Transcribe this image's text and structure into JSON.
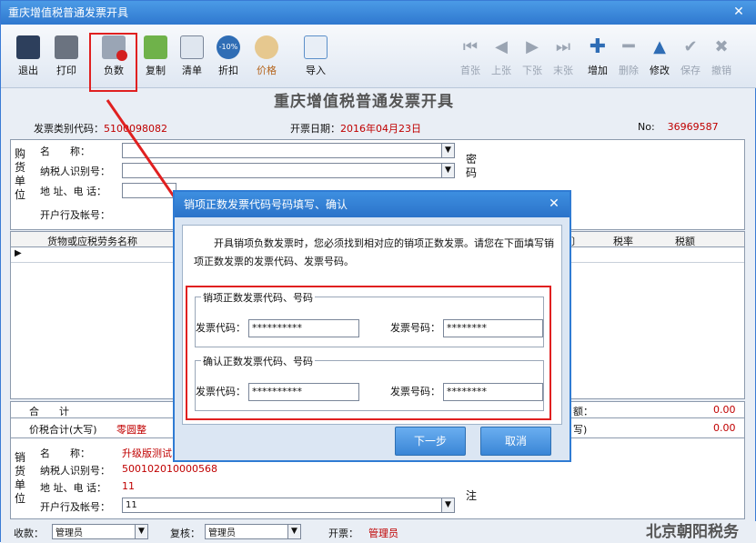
{
  "window": {
    "title": "重庆增值税普通发票开具",
    "close": "✕"
  },
  "toolbar": {
    "exit": "退出",
    "print": "打印",
    "negative": "负数",
    "copy": "复制",
    "list": "清单",
    "discount": "折扣",
    "price": "价格",
    "import": "导入",
    "first": "首张",
    "prev": "上张",
    "next": "下张",
    "last": "末张",
    "add": "增加",
    "delete": "删除",
    "modify": "修改",
    "save": "保存",
    "cancel": "撤销",
    "discount_badge": "-10%"
  },
  "invoice": {
    "title": "重庆增值税普通发票开具",
    "type_code_label": "发票类别代码：",
    "type_code": "5100098082",
    "date_label": "开票日期：",
    "date": "2016年04月23日",
    "no_label": "No:",
    "no": "36969587"
  },
  "buyer": {
    "side": "购货单位",
    "name_label": "名　　称：",
    "tax_id_label": "纳税人识别号：",
    "addr_label": "地 址、电 话：",
    "bank_label": "开户行及帐号："
  },
  "cipher": {
    "label": "密码"
  },
  "grid": {
    "col_goods": "货物或应税劳务名称",
    "col_partial": "〕",
    "col_rate": "税率",
    "col_tax": "税额",
    "row_marker": "▶"
  },
  "totals": {
    "sum_label": "合　　计",
    "amount_label": "价税合计(大写)",
    "amount_value": "零圆整",
    "tax_amount_suffix": "额：",
    "tax_amount_value": "0.00",
    "small_suffix": "写)",
    "small_value": "0.00"
  },
  "seller": {
    "side": "销货单位",
    "name_label": "名　　称：",
    "name_value": "升级版测试",
    "tax_id_label": "纳税人识别号：",
    "tax_id_value": "500102010000568",
    "addr_label": "地 址、电 话：",
    "addr_value": "11",
    "bank_label": "开户行及帐号：",
    "bank_value": "11"
  },
  "remark": {
    "label": "注"
  },
  "footer": {
    "payee_label": "收款：",
    "payee_value": "管理员",
    "reviewer_label": "复核：",
    "reviewer_value": "管理员",
    "issuer_label": "开票：",
    "issuer_value": "管理员",
    "watermark": "北京朝阳税务"
  },
  "dialog": {
    "title": "销项正数发票代码号码填写、确认",
    "close": "✕",
    "instructions": "开具销项负数发票时，您必须找到相对应的销项正数发票。请您在下面填写销项正数发票的发票代码、发票号码。",
    "group1_legend": "销项正数发票代码、号码",
    "group2_legend": "确认正数发票代码、号码",
    "code_label": "发票代码：",
    "number_label": "发票号码：",
    "code1": "**********",
    "number1": "********",
    "code2": "**********",
    "number2": "********",
    "next_button": "下一步",
    "cancel_button": "取消"
  },
  "colors": {
    "accent": "#2f7bd3",
    "highlight": "#e02020",
    "value_red": "#c00000"
  }
}
